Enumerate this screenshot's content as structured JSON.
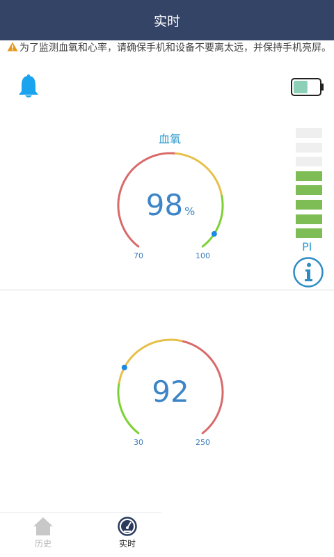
{
  "header": {
    "title": "实时"
  },
  "notice": {
    "text": "为了监测血氧和心率，请确保手机和设备不要离太远，并保持手机亮屏。"
  },
  "icons": {
    "warning": "warning-icon",
    "bell": "bell-icon",
    "battery": "battery-icon",
    "info": "info-icon",
    "home": "home-icon",
    "gauge": "speedometer-icon"
  },
  "battery": {
    "level": 0.55
  },
  "spo2": {
    "title": "血氧",
    "value": "98",
    "unit": "%",
    "min_label": "70",
    "max_label": "100",
    "min": 70,
    "max": 100,
    "current": 98
  },
  "heart": {
    "value": "92",
    "min_label": "30",
    "max_label": "250",
    "min": 30,
    "max": 250,
    "current": 92
  },
  "pi": {
    "label": "PI",
    "bars_total": 8,
    "bars_active": 5,
    "active_color": "#7ebd55",
    "inactive_color": "#efefef"
  },
  "tabs": [
    {
      "label": "历史",
      "active": false
    },
    {
      "label": "实时",
      "active": true
    }
  ],
  "colors": {
    "header": "#344467",
    "accent": "#3d85c6",
    "arc_red": "#d96a6a",
    "arc_yellow": "#e6c04a",
    "arc_green": "#7dd135"
  }
}
